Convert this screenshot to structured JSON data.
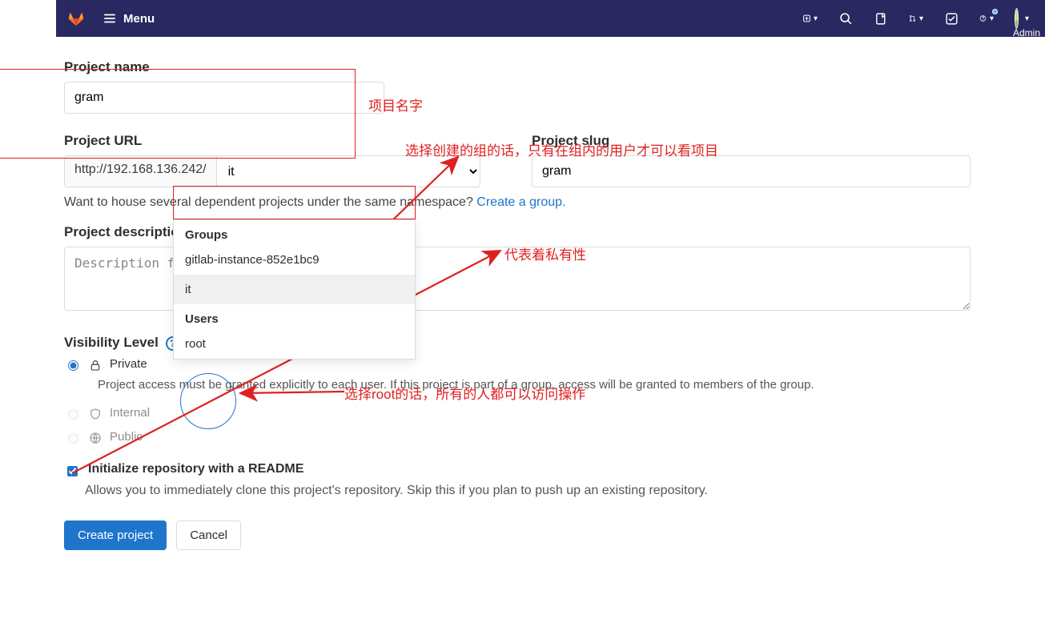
{
  "topbar": {
    "menu_label": "Menu",
    "admin_label": "Admin"
  },
  "labels": {
    "project_name": "Project name",
    "project_url": "Project URL",
    "project_slug": "Project slug",
    "project_desc": "Project description (optional)",
    "visibility": "Visibility Level"
  },
  "form": {
    "name_value": "gram",
    "url_prefix": "http://192.168.136.242/",
    "namespace_selected": "it",
    "slug_value": "gram",
    "desc_placeholder": "Description format",
    "hint_prefix": "Want to house several dependent projects under the same namespace? ",
    "hint_link": "Create a group.",
    "readme_label": "Initialize repository with a README",
    "readme_desc": "Allows you to immediately clone this project's repository. Skip this if you plan to push up an existing repository.",
    "btn_create": "Create project",
    "btn_cancel": "Cancel"
  },
  "dropdown": {
    "groups_hdr": "Groups",
    "group1": "gitlab-instance-852e1bc9",
    "group2": "it",
    "users_hdr": "Users",
    "user1": "root"
  },
  "visibility": {
    "private": {
      "label": "Private",
      "desc": "Project access must be granted explicitly to each user. If this project is part of a group, access will be granted to members of the group."
    },
    "internal": {
      "label": "Internal"
    },
    "public": {
      "label": "Public"
    }
  },
  "annotations": {
    "a1": "项目名字",
    "a2": "选择创建的组的话，只有在组内的用户才可以看项目",
    "a3": "代表着私有性",
    "a4": "选择root的话，所有的人都可以访问操作"
  }
}
